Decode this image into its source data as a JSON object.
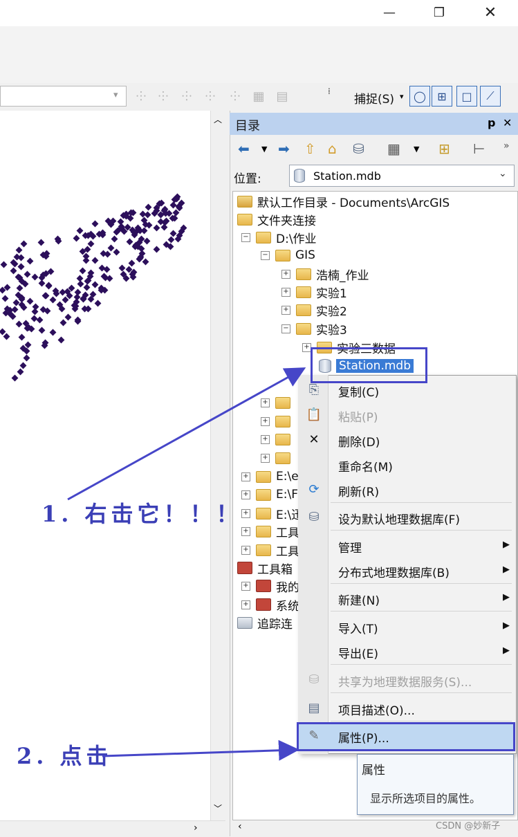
{
  "window": {
    "minimize_icon": "minimize-icon",
    "restore_icon": "restore-icon",
    "close_icon": "close-icon"
  },
  "snapping": {
    "label": "捕捉(S)"
  },
  "catalog": {
    "title": "目录",
    "pin_glyph": "ᵖ",
    "close_glyph": "✕",
    "location_label": "位置:",
    "location_value": "Station.mdb",
    "tree": [
      {
        "label": "默认工作目录 - Documents\\ArcGIS"
      },
      {
        "label": "文件夹连接"
      },
      {
        "label": "D:\\作业"
      },
      {
        "label": "GIS"
      },
      {
        "label": "浩楠_作业"
      },
      {
        "label": "实验1"
      },
      {
        "label": "实验2"
      },
      {
        "label": "实验3"
      },
      {
        "label": "实验三数据"
      },
      {
        "label": "Station.mdb"
      },
      {
        "label": "E:\\e"
      },
      {
        "label": "E:\\F"
      },
      {
        "label": "E:\\迅"
      },
      {
        "label": "工具"
      },
      {
        "label": "工具"
      },
      {
        "label": "工具箱"
      },
      {
        "label": "我的"
      },
      {
        "label": "系统"
      },
      {
        "label": "追踪连"
      }
    ]
  },
  "context_menu": {
    "items": [
      {
        "label": "复制(C)"
      },
      {
        "label": "粘贴(P)"
      },
      {
        "label": "删除(D)"
      },
      {
        "label": "重命名(M)"
      },
      {
        "label": "刷新(R)"
      },
      {
        "label": "设为默认地理数据库(F)"
      },
      {
        "label": "管理"
      },
      {
        "label": "分布式地理数据库(B)"
      },
      {
        "label": "新建(N)"
      },
      {
        "label": "导入(T)"
      },
      {
        "label": "导出(E)"
      },
      {
        "label": "共享为地理数据服务(S)..."
      },
      {
        "label": "项目描述(O)..."
      },
      {
        "label": "属性(P)..."
      }
    ]
  },
  "tooltip": {
    "title": "属性",
    "text": "显示所选项目的属性。"
  },
  "annotations": {
    "step1": "1. 右击它！！！",
    "step2": "2. 点击"
  },
  "watermark": "CSDN @妙新子",
  "colors": {
    "highlight_box": "#4646c8",
    "catalog_title_bg": "#bcd2ef",
    "selection": "#3a7bd5"
  }
}
